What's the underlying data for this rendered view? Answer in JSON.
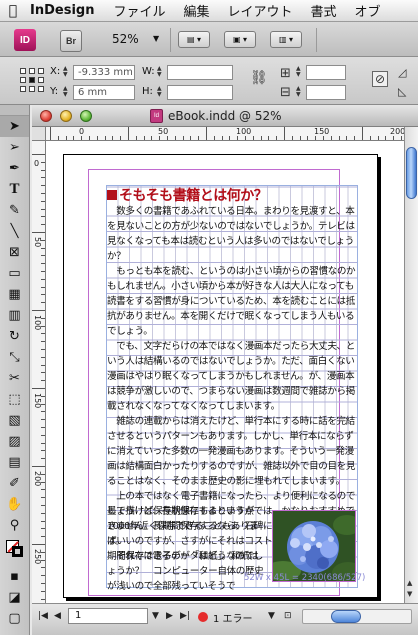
{
  "menubar": {
    "app_name": "InDesign",
    "items": [
      "ファイル",
      "編集",
      "レイアウト",
      "書式",
      "オブ"
    ]
  },
  "appbar": {
    "id_logo": "ID",
    "bridge_label": "Br",
    "zoom": "52%"
  },
  "control": {
    "x_label": "X:",
    "x_value": "-9.333 mm",
    "y_label": "Y:",
    "y_value": "6 mm",
    "w_label": "W:",
    "h_label": "H:"
  },
  "document": {
    "title": "eBook.indd @ 52%",
    "doc_icon": "Id",
    "ruler_h_labels": [
      "0",
      "50",
      "100",
      "150",
      "200"
    ],
    "ruler_v_labels": [
      "0",
      "50",
      "100",
      "150",
      "200",
      "250"
    ],
    "heading": "そもそも書籍とは何か？",
    "body": "　数多くの書籍であふれている日本。まわりを見渡すと、本を見ないことの方が少ないのではないでしょうか。テレビは見なくなっても本は読むという人は多いのではないでしょうか？\n　もっとも本を読む、というのは小さい頃からの習慣なのかもしれません。小さい頃から本が好きな人は大人になっても読書をする習慣が身についているため、本を読むことには抵抗がありません。本を開くだけで眠くなってしまう人もいるでしょう。\n　でも、文字だらけの本ではなく漫画本だったら大丈夫、という人は結構いるのではないでしょうか。ただ、面白くない漫画はやはり眠くなってしまうかもしれません。が、漫画本は競争が激しいので、つまらない漫画は数週間で雑誌から掲載されなくなってなくなってしまいます。\n　雑誌の連載からは消えたけど、単行本にする時に話を完結させるというパターンもあります。しかし、単行本にならずに消えていった多数の一発漫画もあります。そういう一発漫画は結構面白かったりするのですが、雑誌以外で目の目を見ることはなく、そのまま歴史の影に埋もれてしまいます。\n　上の本ではなく電子書籍になったら、より便利になるのでしょうけど、長期保存するという点では、かなりおすすめできません。長期間保存するなら、石碑に直接を描いてしまえばいいのですが、さすがにそれはコスト的に無理。結構、長期間保存できるのが「和紙」。和紙は",
    "body2": "墨で描けば保存状態にもよりますが1000年近く保存できることもあります。\n　それでは電子データはどうなのでしょうか？　コンピューター自体の歴史が浅いので全部残っていそうで",
    "dims_label": "52W x 45L = 2340(686/527)"
  },
  "statusbar": {
    "page_number": "1",
    "errors": "1 エラー"
  },
  "colors": {
    "heading": "#b20f1a",
    "error_dot": "#e52b2b",
    "accent": "#4f86d9"
  }
}
